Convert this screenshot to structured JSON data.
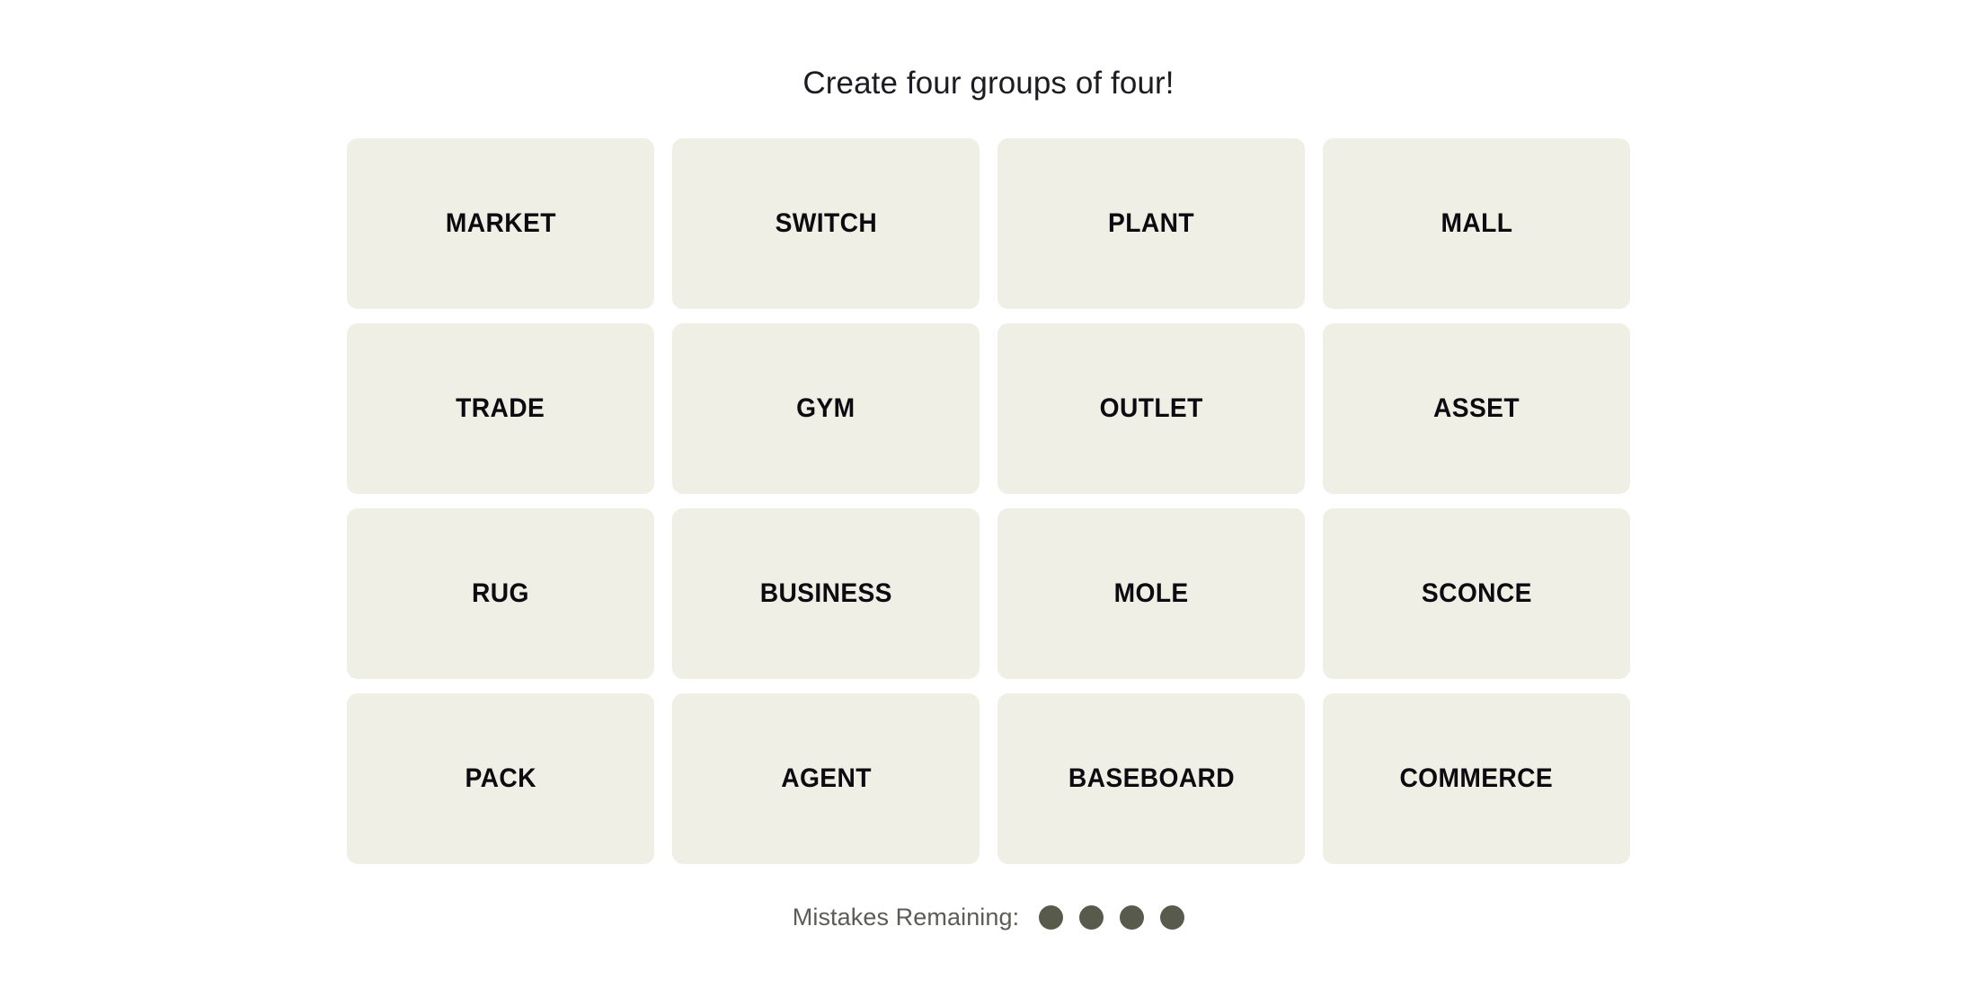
{
  "game": {
    "title": "Create four groups of four!",
    "board_color": "#efefe6",
    "tile_text_color": "#0b0b10",
    "page_background": "#ffffff",
    "title_color": "#1b1b22"
  },
  "tiles": [
    {
      "label": "MARKET"
    },
    {
      "label": "SWITCH"
    },
    {
      "label": "PLANT"
    },
    {
      "label": "MALL"
    },
    {
      "label": "TRADE"
    },
    {
      "label": "GYM"
    },
    {
      "label": "OUTLET"
    },
    {
      "label": "ASSET"
    },
    {
      "label": "RUG"
    },
    {
      "label": "BUSINESS"
    },
    {
      "label": "MOLE"
    },
    {
      "label": "SCONCE"
    },
    {
      "label": "PACK"
    },
    {
      "label": "AGENT"
    },
    {
      "label": "BASEBOARD"
    },
    {
      "label": "COMMERCE"
    }
  ],
  "mistakes": {
    "label": "Mistakes Remaining:",
    "remaining": 4,
    "total": 4,
    "dot_color": "#585b4c",
    "label_color": "#5c5c57",
    "dots": [
      {
        "state": "available"
      },
      {
        "state": "available"
      },
      {
        "state": "available"
      },
      {
        "state": "available"
      }
    ]
  }
}
